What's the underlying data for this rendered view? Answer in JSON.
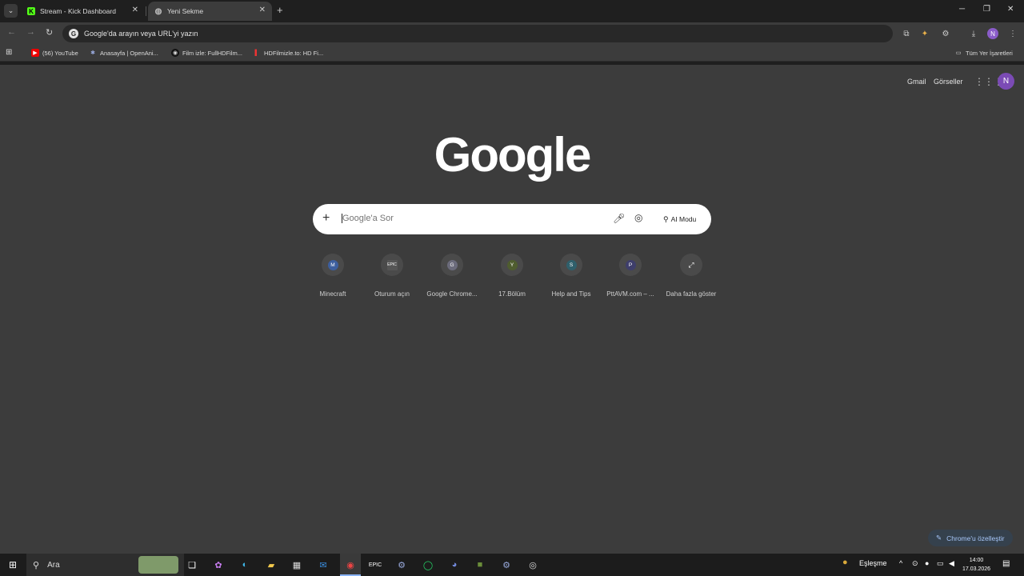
{
  "tabs": [
    {
      "title": "Stream - Kick Dashboard",
      "favicon": "K"
    },
    {
      "title": "Yeni Sekme",
      "favicon": "globe-icon"
    }
  ],
  "omnibox": {
    "text": "Google'da arayın veya URL'yi yazın"
  },
  "bookmarks": [
    {
      "label": "(56) YouTube"
    },
    {
      "label": "Anasayfa | OpenAni..."
    },
    {
      "label": "Film izle: FullHDFilm..."
    },
    {
      "label": "HDFilmizle.to: HD Fi..."
    }
  ],
  "all_bookmarks": "Tüm Yer İşaretleri",
  "header_links": {
    "gmail": "Gmail",
    "images": "Görseller",
    "avatar": "N"
  },
  "logo": "Google",
  "search": {
    "placeholder": "Google'a Sor",
    "ai_mode": "AI Modu"
  },
  "shortcuts": [
    {
      "label": "Minecraft",
      "letter": "M",
      "color": "#3d5f9e"
    },
    {
      "label": "Oturum açın",
      "letter": "EPIC",
      "color": "#555555"
    },
    {
      "label": "Google Chrome...",
      "letter": "G",
      "color": "#6b6b7b"
    },
    {
      "label": "17.Bölüm",
      "letter": "Y",
      "color": "#4f5d2f"
    },
    {
      "label": "Help and Tips",
      "letter": "S",
      "color": "#2f5f6b"
    },
    {
      "label": "PttAVM.com – ...",
      "letter": "P",
      "color": "#3e3e6b"
    },
    {
      "label": "Daha fazla göster",
      "letter": "⤢",
      "color": "#4a4a4a"
    }
  ],
  "customize": "Chrome'u özelleştir",
  "taskbar": {
    "search": "Ara",
    "tray_label": "Eşleşme",
    "time": "14:00",
    "date": "17.03.2026"
  }
}
